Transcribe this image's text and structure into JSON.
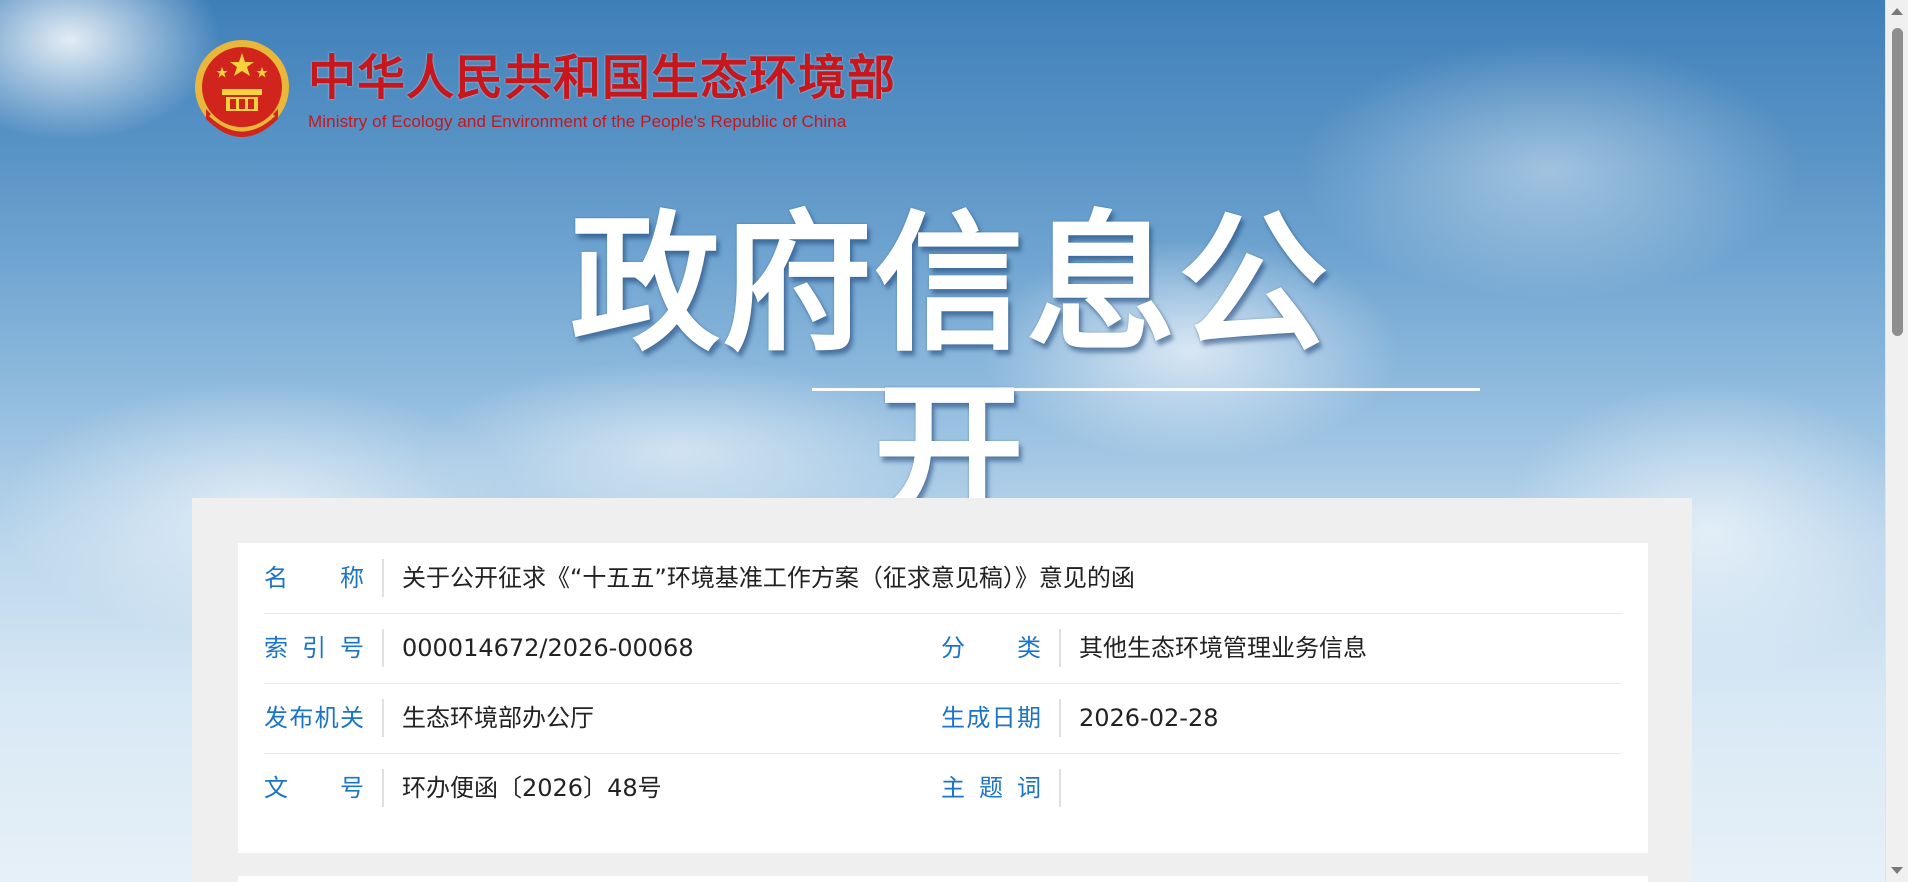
{
  "site": {
    "name_cn": "中华人民共和国生态环境部",
    "name_en": "Ministry of Ecology and Environment of the People's Republic of China",
    "emblem_icon": "national-emblem-icon"
  },
  "hero": {
    "title": "政府信息公开"
  },
  "info": {
    "name_label": "名　　称",
    "name_value": "关于公开征求《“十五五”环境基准工作方案（征求意见稿）》意见的函",
    "index_label": "索 引 号",
    "index_value": "000014672/2026-00068",
    "category_label": "分　　类",
    "category_value": "其他生态环境管理业务信息",
    "issuer_label": "发布机关",
    "issuer_value": "生态环境部办公厅",
    "date_label": "生成日期",
    "date_value": "2026-02-28",
    "doc_no_label": "文　　号",
    "doc_no_value": "环办便函〔2026〕48号",
    "keywords_label": "主 题 词",
    "keywords_value": ""
  },
  "colors": {
    "brand_red": "#c8161d",
    "label_blue": "#1c74c7"
  }
}
